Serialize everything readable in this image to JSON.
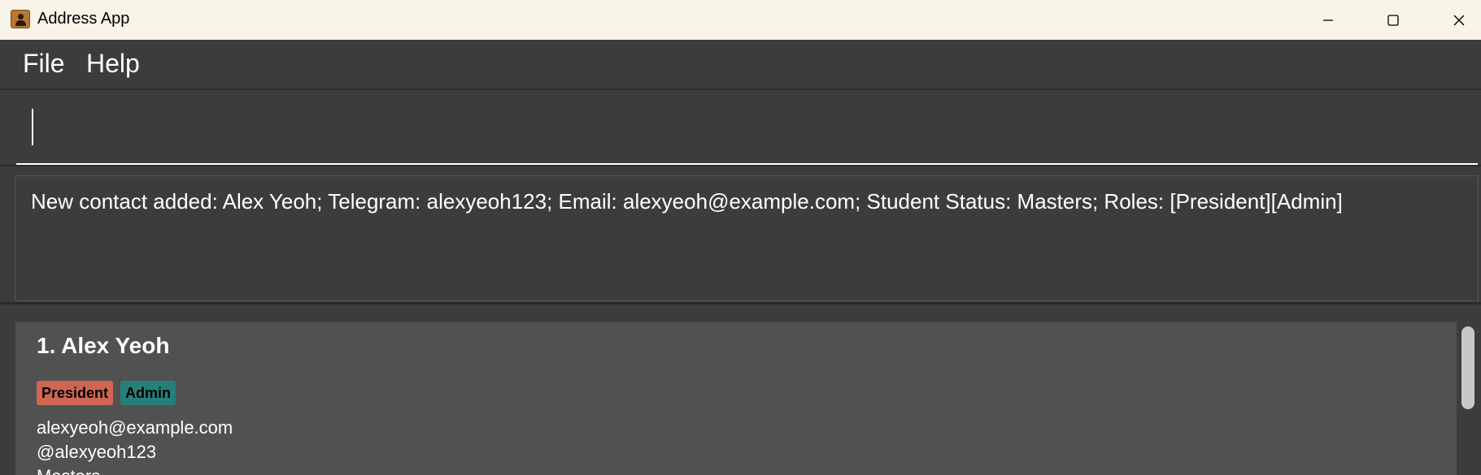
{
  "window": {
    "title": "Address App",
    "icon": "address-book-icon",
    "controls": [
      "minimize-icon",
      "maximize-icon",
      "close-icon"
    ]
  },
  "menu": {
    "items": [
      {
        "label": "File"
      },
      {
        "label": "Help"
      }
    ]
  },
  "command_box": {
    "value": "",
    "placeholder": ""
  },
  "result_display": {
    "text": "New contact added: Alex Yeoh; Telegram: alexyeoh123; Email: alexyeoh@example.com; Student Status: Masters; Roles: [President][Admin]"
  },
  "person_list": {
    "cards": [
      {
        "index_name": "1. Alex Yeoh",
        "tags": [
          {
            "label": "President",
            "color": "#d06651"
          },
          {
            "label": "Admin",
            "color": "#26807a"
          }
        ],
        "email": "alexyeoh@example.com",
        "telegram": "@alexyeoh123",
        "status": "Masters"
      }
    ]
  },
  "colors": {
    "background": "#3c3c3c",
    "card": "#515151",
    "titlebar": "#f8f4e8",
    "text": "#ffffff"
  }
}
